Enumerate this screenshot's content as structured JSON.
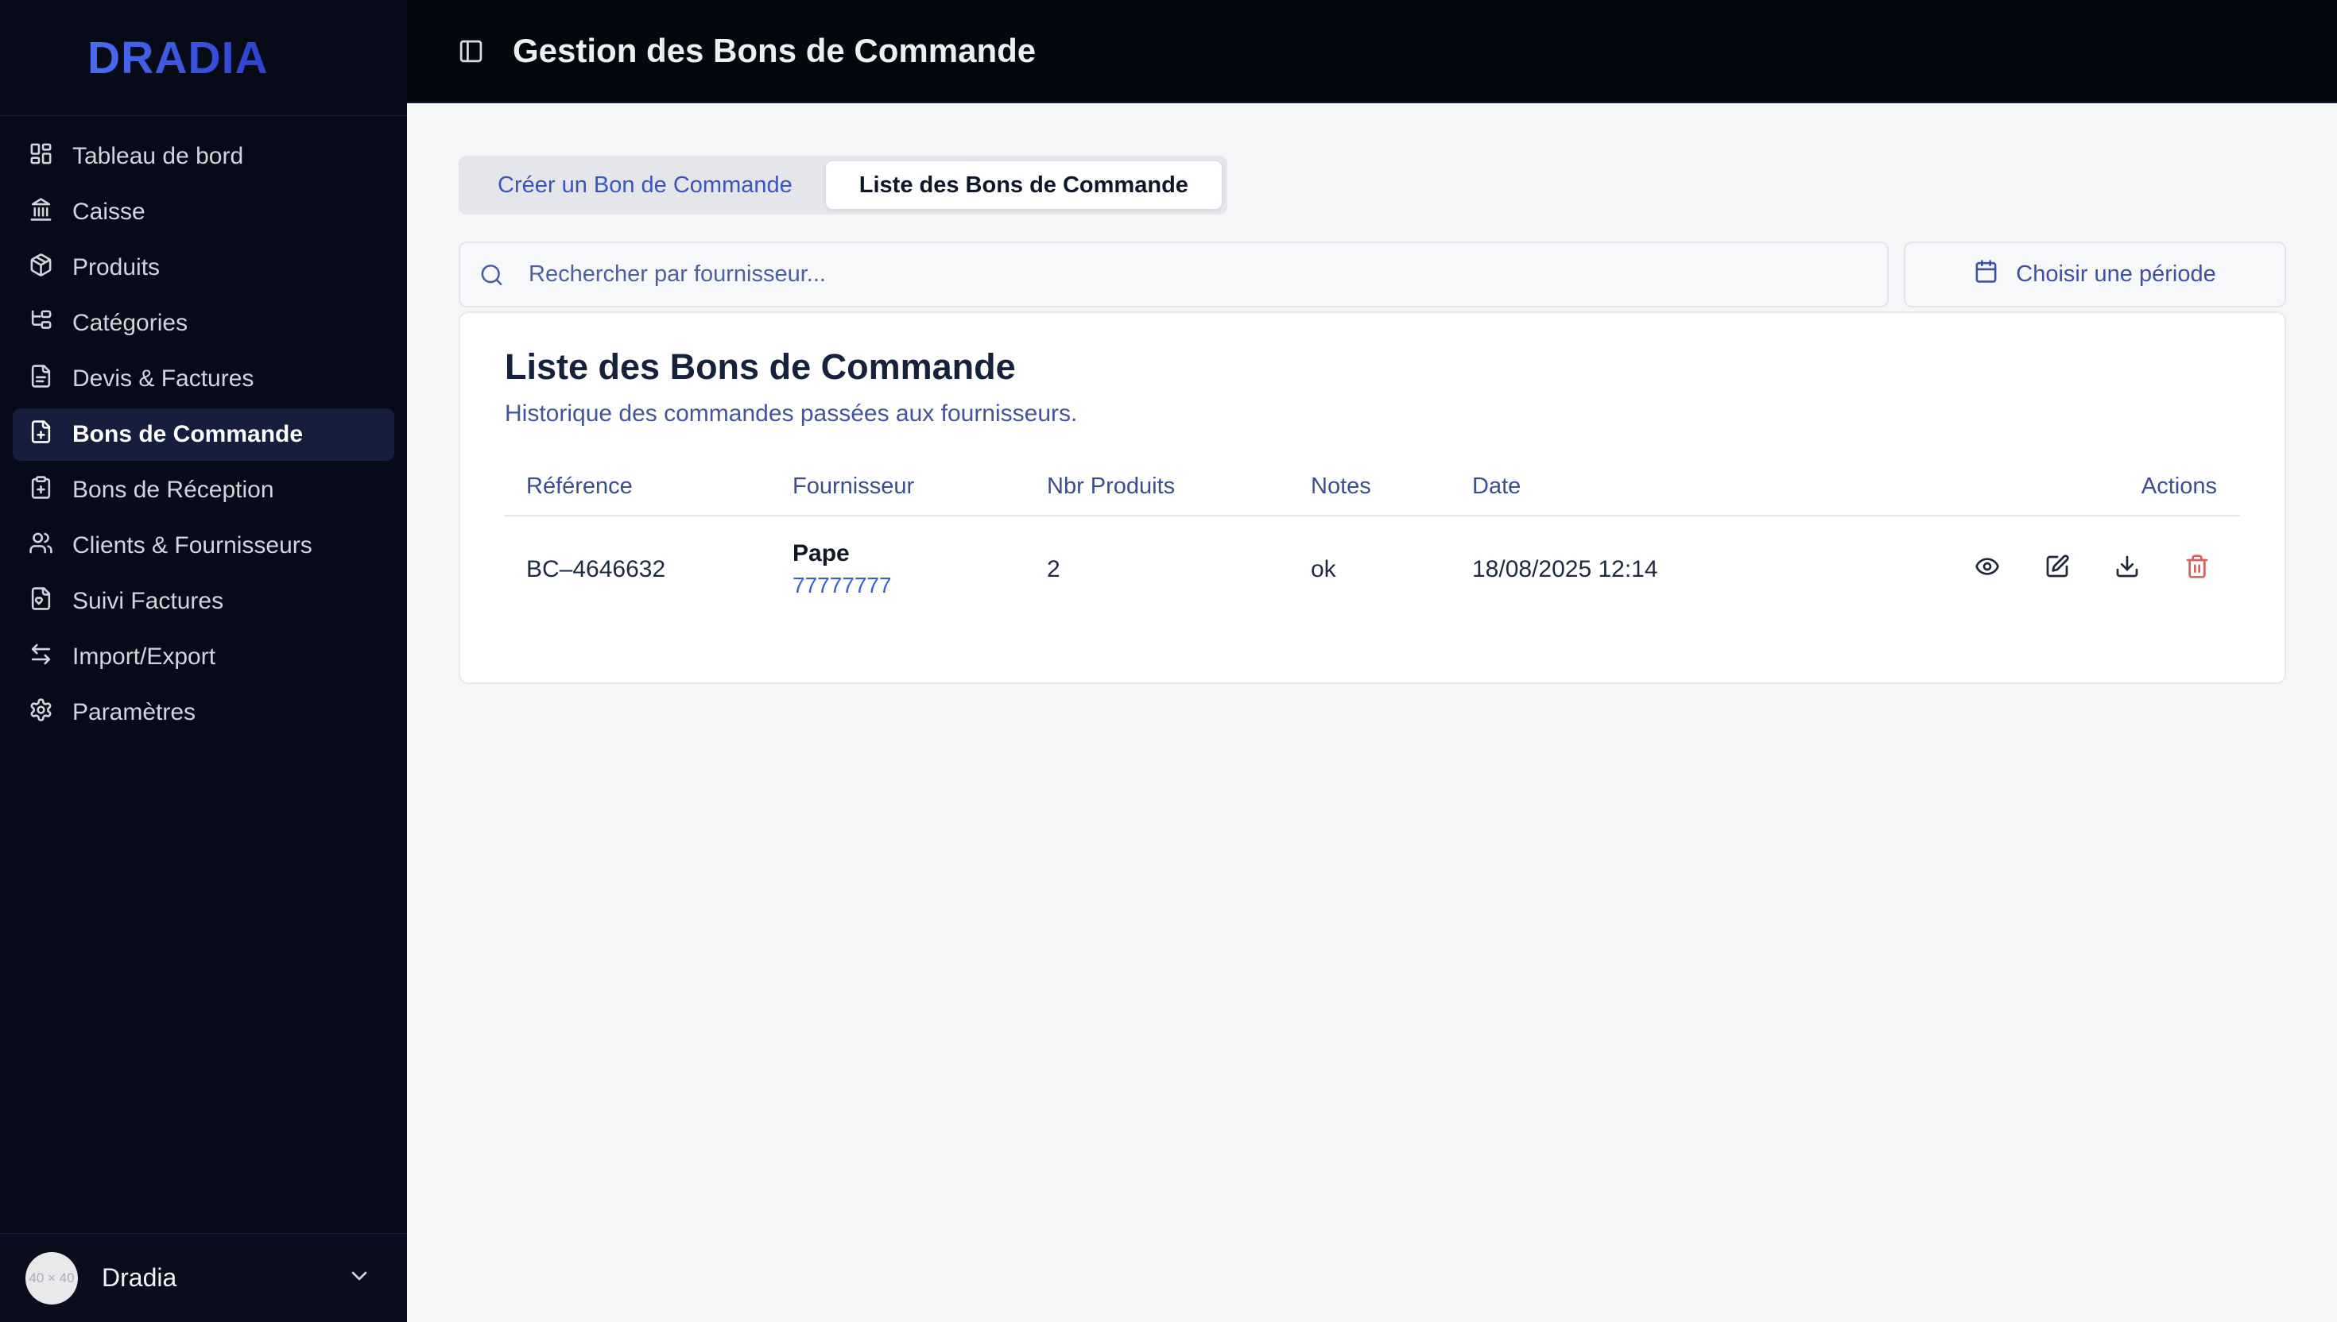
{
  "brand": {
    "logo": "DRADIA"
  },
  "sidebar": {
    "items": [
      {
        "label": "Tableau de bord",
        "icon": "dashboard-icon",
        "active": false
      },
      {
        "label": "Caisse",
        "icon": "bank-icon",
        "active": false
      },
      {
        "label": "Produits",
        "icon": "package-icon",
        "active": false
      },
      {
        "label": "Catégories",
        "icon": "category-tree-icon",
        "active": false
      },
      {
        "label": "Devis & Factures",
        "icon": "file-text-icon",
        "active": false
      },
      {
        "label": "Bons de Commande",
        "icon": "file-plus-icon",
        "active": true
      },
      {
        "label": "Bons de Réception",
        "icon": "clipboard-plus-icon",
        "active": false
      },
      {
        "label": "Clients & Fournisseurs",
        "icon": "users-icon",
        "active": false
      },
      {
        "label": "Suivi Factures",
        "icon": "file-heart-icon",
        "active": false
      },
      {
        "label": "Import/Export",
        "icon": "arrows-left-right-icon",
        "active": false
      },
      {
        "label": "Paramètres",
        "icon": "gear-icon",
        "active": false
      }
    ],
    "user": {
      "name": "Dradia",
      "avatar_placeholder": "40 × 40"
    }
  },
  "header": {
    "title": "Gestion des Bons de Commande"
  },
  "tabs": [
    {
      "label": "Créer un Bon de Commande",
      "active": false
    },
    {
      "label": "Liste des Bons de Commande",
      "active": true
    }
  ],
  "toolbar": {
    "search_placeholder": "Rechercher par fournisseur...",
    "period_button": "Choisir une période"
  },
  "card": {
    "title": "Liste des Bons de Commande",
    "subtitle": "Historique des commandes passées aux fournisseurs.",
    "table": {
      "columns": [
        "Référence",
        "Fournisseur",
        "Nbr Produits",
        "Notes",
        "Date",
        "Actions"
      ],
      "rows": [
        {
          "reference": "BC–4646632",
          "fournisseur": "Pape",
          "fournisseur_phone": "77777777",
          "nbr_produits": "2",
          "notes": "ok",
          "date": "18/08/2025 12:14"
        }
      ],
      "row_actions": [
        "view",
        "edit",
        "download",
        "delete"
      ]
    }
  },
  "colors": {
    "brand_blue": "#3a55e0",
    "link_blue": "#3b5bd9",
    "danger_red": "#e05b5b",
    "sidebar_bg": "#070b17",
    "main_bg": "#f5f6f8"
  }
}
